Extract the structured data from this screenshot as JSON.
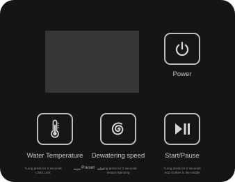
{
  "panel": {
    "power": {
      "label": "Power",
      "icon": "power-icon"
    },
    "buttons": [
      {
        "label": "Water Temperature",
        "icon": "thermometer-icon",
        "note": [
          "*Long press for 2 seconds",
          "Child Lock"
        ]
      },
      {
        "label": "Dewatering speed",
        "icon": "spiral-icon",
        "note": [
          "*Long press for 2 seconds",
          "Instant Spinning"
        ]
      },
      {
        "label": "Start/Pause",
        "icon": "play-pause-icon",
        "note": [
          "*Long press for 2 seconds",
          "Add clothes in the middle"
        ]
      }
    ],
    "preset": "Preset"
  },
  "colors": {
    "panel": "#151515",
    "display": "#363636",
    "button_border": "#bdbdbd",
    "label_text": "#c8c8c8"
  }
}
